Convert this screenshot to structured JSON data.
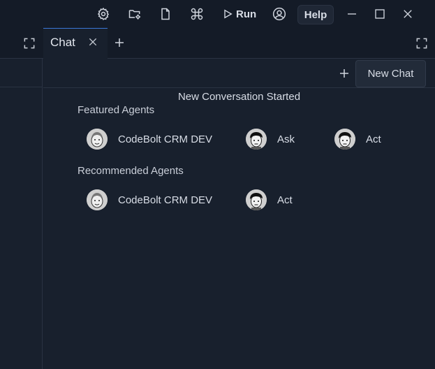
{
  "titlebar": {
    "icons": [
      "settings-icon",
      "folder-settings-icon",
      "file-icon",
      "command-icon"
    ],
    "run_label": "Run",
    "help_label": "Help",
    "window_controls": [
      "minimize-icon",
      "maximize-icon",
      "close-icon"
    ]
  },
  "tabs": [
    {
      "label": "Chat",
      "active": true
    }
  ],
  "chat": {
    "new_chat_tooltip": "New Chat",
    "conversation_status": "New Conversation Started",
    "featured": {
      "heading": "Featured Agents",
      "agents": [
        {
          "name": "CodeBolt CRM DEV",
          "avatar": "cartoon-face-icon"
        },
        {
          "name": "Ask",
          "avatar": "cartoon-face-dark-hair-icon"
        },
        {
          "name": "Act",
          "avatar": "cartoon-face-dark-hair-icon"
        }
      ]
    },
    "recommended": {
      "heading": "Recommended Agents",
      "agents": [
        {
          "name": "CodeBolt CRM DEV",
          "avatar": "cartoon-face-icon"
        },
        {
          "name": "Act",
          "avatar": "cartoon-face-dark-hair-icon"
        }
      ]
    }
  },
  "colors": {
    "background": "#18202d",
    "titlebar": "#141b27",
    "accent": "#3a78d8",
    "text": "#d8dde6"
  }
}
